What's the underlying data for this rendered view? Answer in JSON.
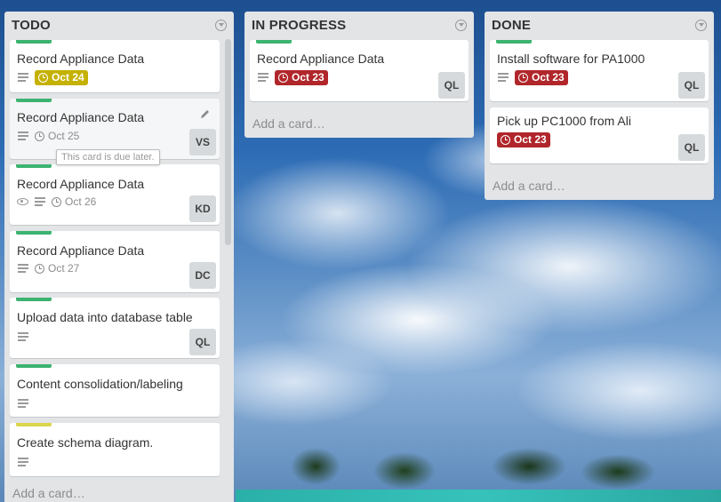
{
  "lists": [
    {
      "title": "TODO",
      "add_card": "Add a card…",
      "cards": [
        {
          "title": "Record Appliance Data",
          "label_color": "#3cb371",
          "due": "Oct 24",
          "due_status": "soon",
          "member": ""
        },
        {
          "title": "Record Appliance Data",
          "label_color": "#3cb371",
          "due": "Oct 25",
          "due_status": "plain",
          "member": "VS",
          "tooltip": "This card is due later."
        },
        {
          "title": "Record Appliance Data",
          "label_color": "#3cb371",
          "due": "Oct 26",
          "due_status": "plain",
          "member": "KD",
          "watched": true
        },
        {
          "title": "Record Appliance Data",
          "label_color": "#3cb371",
          "due": "Oct 27",
          "due_status": "plain",
          "member": "DC"
        },
        {
          "title": "Upload data into database table",
          "label_color": "#3cb371",
          "member": "QL"
        },
        {
          "title": "Content consolidation/labeling",
          "label_color": "#3cb371",
          "member": ""
        },
        {
          "title": "Create schema diagram.",
          "label_color": "#d9d64b",
          "member": ""
        }
      ]
    },
    {
      "title": "IN PROGRESS",
      "add_card": "Add a card…",
      "cards": [
        {
          "title": "Record Appliance Data",
          "label_color": "#3cb371",
          "due": "Oct 23",
          "due_status": "past",
          "member": "QL"
        }
      ]
    },
    {
      "title": "DONE",
      "add_card": "Add a card…",
      "cards": [
        {
          "title": "Install software for PA1000",
          "label_color": "#3cb371",
          "due": "Oct 23",
          "due_status": "past",
          "member": "QL"
        },
        {
          "title": "Pick up PC1000 from Ali",
          "due": "Oct 23",
          "due_status": "past",
          "member": "QL"
        }
      ]
    }
  ],
  "icons": {
    "list_menu": "chevron-circle-icon",
    "description": "description-lines-icon",
    "due_date": "clock-icon",
    "watch": "eye-icon",
    "edit": "pencil-icon"
  }
}
